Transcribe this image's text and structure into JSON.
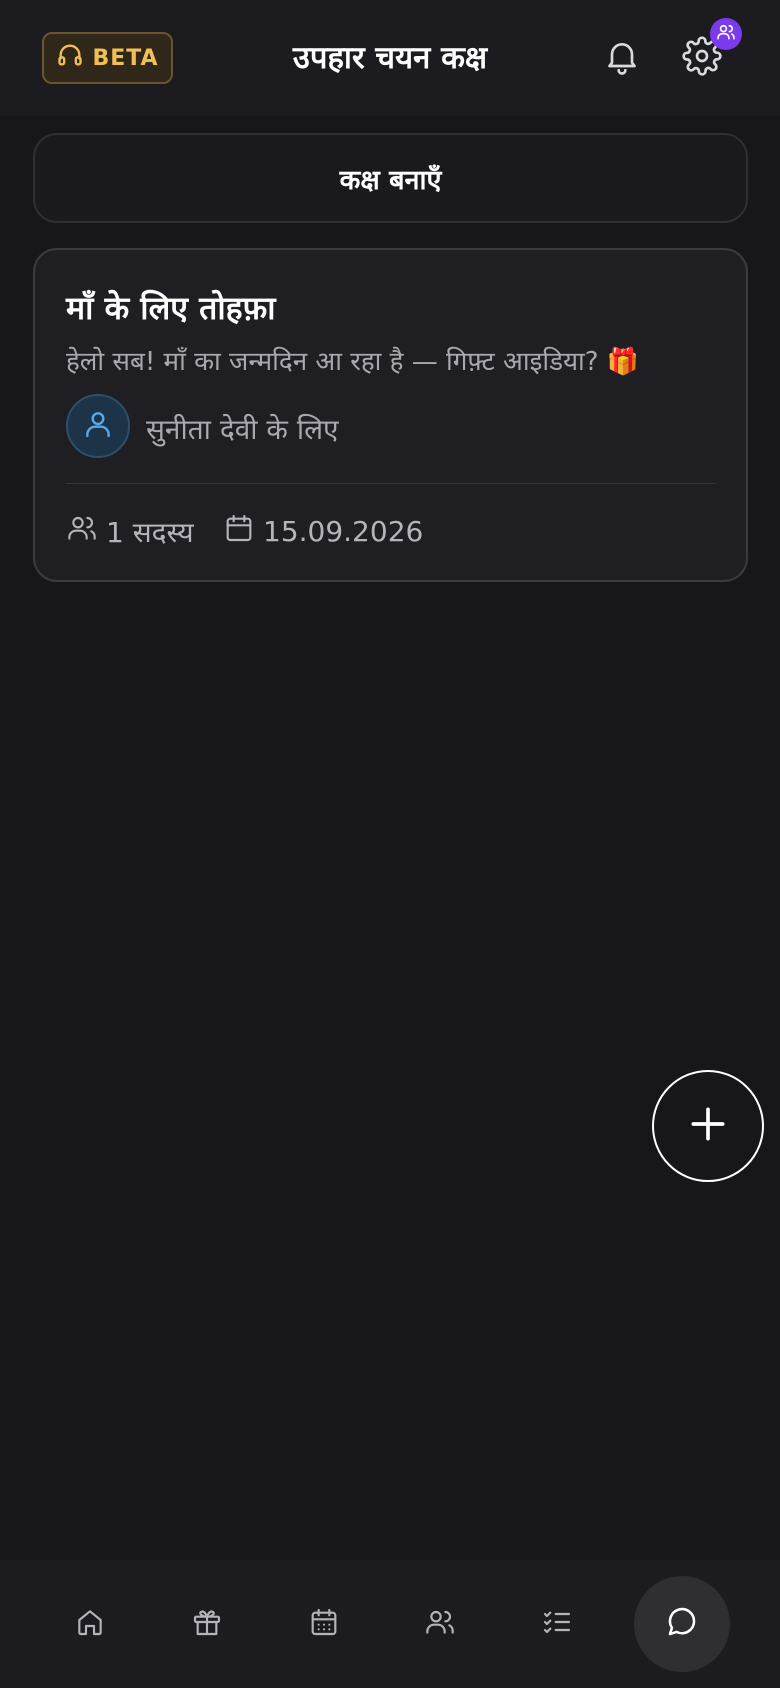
{
  "header": {
    "beta_label": "BETA",
    "title": "उपहार चयन कक्ष",
    "icons": {
      "beta": "headphones-icon",
      "notifications": "bell-icon",
      "settings": "gear-icon",
      "badge": "users-icon"
    }
  },
  "create_room": {
    "label": "कक्ष बनाएँ"
  },
  "rooms": [
    {
      "title": "माँ के लिए तोहफ़ा",
      "description": "हेलो सब! माँ का जन्मदिन आ रहा है — गिफ़्ट आइडिया? 🎁",
      "recipient": "सुनीता देवी के लिए",
      "members": "1 सदस्य",
      "date": "15.09.2026"
    }
  ],
  "fab": {
    "icon": "plus-icon"
  },
  "bottom_nav": {
    "items": [
      "home-icon",
      "gift-icon",
      "calendar-icon",
      "users-icon",
      "checklist-icon",
      "chat-icon"
    ],
    "active": "chat-icon"
  },
  "colors": {
    "background": "#17171a",
    "header": "#1c1c20",
    "beta_text": "#f2bf55",
    "badge": "#7c3aed",
    "avatar_icon": "#5aa8e8"
  }
}
